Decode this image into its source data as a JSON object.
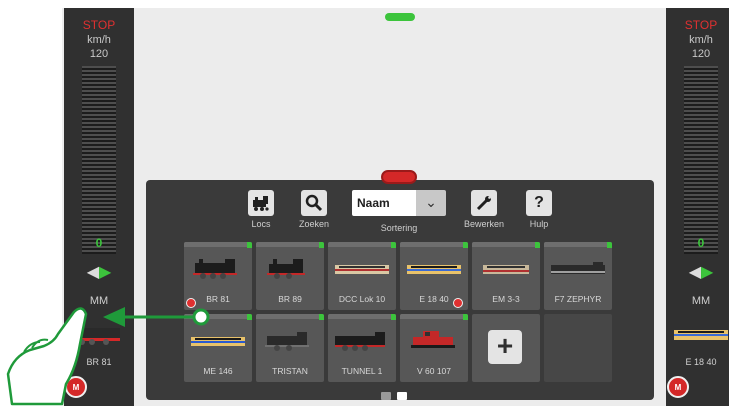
{
  "left_throttle": {
    "stop": "STOP",
    "unit": "km/h",
    "max_speed": "120",
    "speed": "0",
    "protocol": "MM",
    "loco_name": "BR 81",
    "direction": "forward"
  },
  "right_throttle": {
    "stop": "STOP",
    "unit": "km/h",
    "max_speed": "120",
    "speed": "0",
    "protocol": "MM",
    "loco_name": "E 18 40",
    "direction": "forward"
  },
  "toolbar": {
    "locs": "Locs",
    "zoeken": "Zoeken",
    "sort_value": "Naam",
    "sort_label": "Sortering",
    "bewerken": "Bewerken",
    "hulp": "Hulp",
    "help_glyph": "?",
    "plus_glyph": "+"
  },
  "locos": [
    {
      "name": "BR 81"
    },
    {
      "name": "BR 89"
    },
    {
      "name": "DCC Lok 10"
    },
    {
      "name": "E 18 40"
    },
    {
      "name": "EM 3-3"
    },
    {
      "name": "F7 ZEPHYR"
    },
    {
      "name": "ME 146"
    },
    {
      "name": "TRISTAN"
    },
    {
      "name": "TUNNEL 1"
    },
    {
      "name": "V 60 107"
    }
  ],
  "logo_text": "M",
  "icons": {
    "locs": "steam-loco-icon",
    "zoeken": "magnifier-icon",
    "sort": "chevron-down-icon",
    "bewerken": "wrench-icon",
    "hulp": "question-icon",
    "add": "plus-icon",
    "hand": "pointing-hand-icon"
  },
  "colors": {
    "stop": "#e03030",
    "active_direction": "#3cc43c",
    "drag_arrow": "#1f9a3a",
    "brand": "#d42828"
  }
}
